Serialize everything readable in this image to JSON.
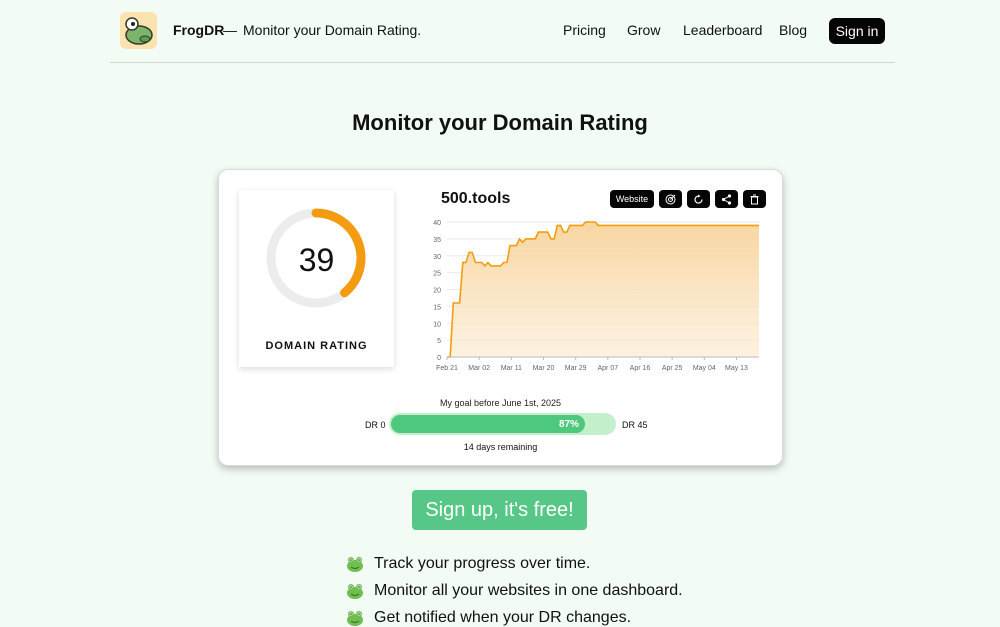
{
  "header": {
    "brand": "FrogDR",
    "dash": "—",
    "tagline": "Monitor your Domain Rating.",
    "nav": [
      "Pricing",
      "Grow",
      "Leaderboard",
      "Blog"
    ],
    "signin": "Sign in"
  },
  "hero": {
    "title": "Monitor your Domain Rating"
  },
  "card": {
    "dr_value": "39",
    "dr_percent": 39,
    "dr_label": "DOMAIN RATING",
    "site": "500.tools",
    "buttons": {
      "website": "Website"
    },
    "goal": {
      "title": "My goal before June 1st, 2025",
      "start": "DR 0",
      "end": "DR 45",
      "percent_label": "87%",
      "percent": 87,
      "remaining": "14 days remaining"
    }
  },
  "chart_data": {
    "type": "area",
    "x": [
      "Feb 21",
      "Mar 02",
      "Mar 11",
      "Mar 20",
      "Mar 29",
      "Apr 07",
      "Apr 16",
      "Apr 25",
      "May 04",
      "May 13"
    ],
    "points": [
      [
        0,
        0
      ],
      [
        1,
        0
      ],
      [
        2,
        16
      ],
      [
        3,
        16
      ],
      [
        4,
        16
      ],
      [
        5,
        28
      ],
      [
        6,
        28
      ],
      [
        7,
        31
      ],
      [
        8,
        31
      ],
      [
        9,
        28
      ],
      [
        10,
        28
      ],
      [
        11,
        28
      ],
      [
        12,
        27
      ],
      [
        13,
        28
      ],
      [
        14,
        27
      ],
      [
        15,
        27
      ],
      [
        16,
        27
      ],
      [
        17,
        27
      ],
      [
        18,
        28
      ],
      [
        19,
        28
      ],
      [
        20,
        33
      ],
      [
        21,
        33
      ],
      [
        22,
        33
      ],
      [
        23,
        35
      ],
      [
        24,
        34
      ],
      [
        25,
        35
      ],
      [
        26,
        35
      ],
      [
        27,
        35
      ],
      [
        28,
        35
      ],
      [
        29,
        37
      ],
      [
        30,
        37
      ],
      [
        31,
        37
      ],
      [
        32,
        37
      ],
      [
        33,
        35
      ],
      [
        34,
        35
      ],
      [
        35,
        39
      ],
      [
        36,
        39
      ],
      [
        37,
        37
      ],
      [
        38,
        37
      ],
      [
        39,
        39
      ],
      [
        40,
        39
      ],
      [
        41,
        39
      ],
      [
        42,
        39
      ],
      [
        43,
        39
      ],
      [
        44,
        40
      ],
      [
        45,
        40
      ],
      [
        46,
        40
      ],
      [
        47,
        40
      ],
      [
        48,
        39
      ],
      [
        49,
        39
      ],
      [
        50,
        39
      ],
      [
        51,
        39
      ],
      [
        52,
        39
      ],
      [
        53,
        39
      ],
      [
        54,
        39
      ],
      [
        55,
        39
      ],
      [
        56,
        39
      ],
      [
        57,
        39
      ],
      [
        58,
        39
      ],
      [
        59,
        39
      ],
      [
        60,
        39
      ],
      [
        61,
        39
      ],
      [
        62,
        39
      ],
      [
        63,
        39
      ],
      [
        64,
        39
      ],
      [
        65,
        39
      ],
      [
        66,
        39
      ],
      [
        67,
        39
      ],
      [
        68,
        39
      ],
      [
        69,
        39
      ],
      [
        70,
        39
      ],
      [
        71,
        39
      ],
      [
        72,
        39
      ],
      [
        73,
        39
      ],
      [
        74,
        39
      ],
      [
        75,
        39
      ],
      [
        76,
        39
      ],
      [
        77,
        39
      ],
      [
        78,
        39
      ],
      [
        79,
        39
      ],
      [
        80,
        39
      ],
      [
        81,
        39
      ],
      [
        82,
        39
      ],
      [
        83,
        39
      ],
      [
        84,
        39
      ],
      [
        85,
        39
      ],
      [
        86,
        39
      ],
      [
        87,
        39
      ],
      [
        88,
        39
      ],
      [
        89,
        39
      ],
      [
        90,
        39
      ],
      [
        91,
        39
      ],
      [
        92,
        39
      ],
      [
        93,
        39
      ],
      [
        94,
        39
      ],
      [
        95,
        39
      ],
      [
        96,
        39
      ],
      [
        97,
        39
      ],
      [
        98,
        39
      ],
      [
        99,
        39
      ]
    ],
    "yticks": [
      0,
      5,
      10,
      15,
      20,
      25,
      30,
      35,
      40
    ],
    "ylim": [
      0,
      40
    ],
    "grid": true,
    "line_color": "#f39c12",
    "fill_color": "#f8d9a6"
  },
  "cta": {
    "label": "Sign up, it's free!"
  },
  "features": [
    "Track your progress over time.",
    "Monitor all your websites in one dashboard.",
    "Get notified when your DR changes."
  ],
  "colors": {
    "accent": "#56c786",
    "gauge": "#f39c12",
    "background": "#f3fbf5"
  },
  "icons": [
    "frog-logo-icon",
    "target-icon",
    "refresh-icon",
    "share-icon",
    "trash-icon",
    "frog-icon"
  ]
}
